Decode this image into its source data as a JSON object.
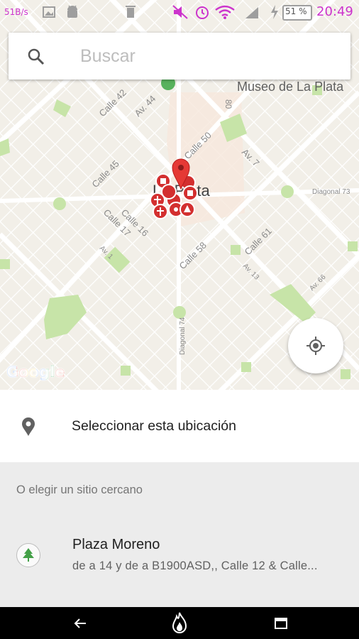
{
  "status_bar": {
    "net_speed": "51B/s",
    "battery": "51 %",
    "time": "20:49"
  },
  "map": {
    "street_labels": [
      "Calle 42",
      "Av. 44",
      "Calle 45",
      "Calle 50",
      "Calle 16",
      "Calle 17",
      "Av. 7",
      "Calle 58",
      "Calle 61",
      "Av. 13",
      "Av. 66",
      "Diagonal 73",
      "Diagonal 74",
      "Av. 1",
      "80"
    ],
    "poi_label": "Museo de La Plata",
    "city_label": "La Plata",
    "attribution": "Google"
  },
  "search": {
    "placeholder": "Buscar"
  },
  "select_location": {
    "label": "Seleccionar esta ubicación"
  },
  "nearby": {
    "heading": "O elegir un sitio cercano",
    "places": [
      {
        "name": "Plaza Moreno",
        "address": "de a 14 y de a B1900ASD,, Calle 12 & Calle..."
      }
    ]
  },
  "colors": {
    "map_background": "#f2efe8",
    "park_green": "#c7e4a8",
    "marker_red": "#d32f2f",
    "accent_magenta": "#cc33cc"
  },
  "icons": {
    "search": "magnifier",
    "locate": "crosshair",
    "select": "map-pin",
    "place": "tree",
    "nav_back": "arrow-left",
    "nav_home": "flame",
    "nav_recents": "window"
  }
}
